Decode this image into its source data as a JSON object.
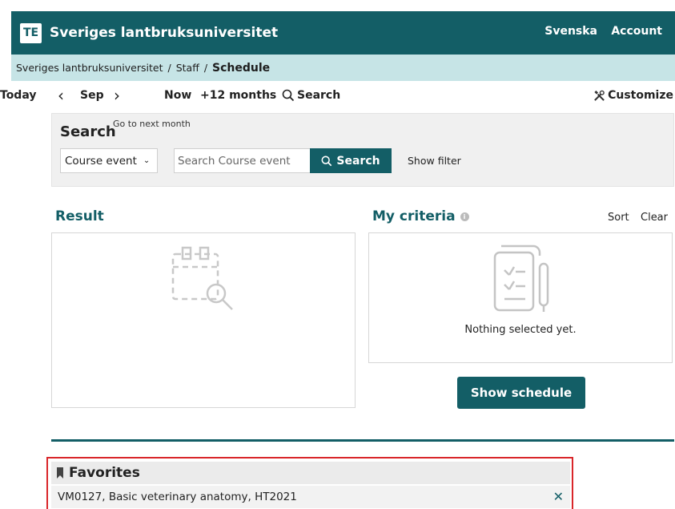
{
  "header": {
    "logo_text": "TE",
    "title": "Sveriges lantbruksuniversitet",
    "language_link": "Svenska",
    "account_link": "Account"
  },
  "breadcrumb": {
    "items": [
      "Sveriges lantbruksuniversitet",
      "Staff"
    ],
    "current": "Schedule",
    "separator": "/"
  },
  "toolbar": {
    "today": "Today",
    "month": "Sep",
    "now": "Now",
    "range": "+12 months",
    "search": "Search",
    "customize": "Customize"
  },
  "search_panel": {
    "title": "Search",
    "tooltip": "Go to next month",
    "type_selected": "Course event",
    "input_placeholder": "Search Course event",
    "button_label": "Search",
    "show_filter": "Show filter"
  },
  "result": {
    "title": "Result"
  },
  "criteria": {
    "title": "My criteria",
    "sort": "Sort",
    "clear": "Clear",
    "empty_text": "Nothing selected yet."
  },
  "show_schedule_label": "Show schedule",
  "favorites": {
    "title": "Favorites",
    "items": [
      "VM0127, Basic veterinary anatomy, HT2021"
    ]
  },
  "colors": {
    "brand": "#135e66",
    "breadcrumb_bg": "#c6e4e6",
    "highlight_border": "#d9262a"
  }
}
